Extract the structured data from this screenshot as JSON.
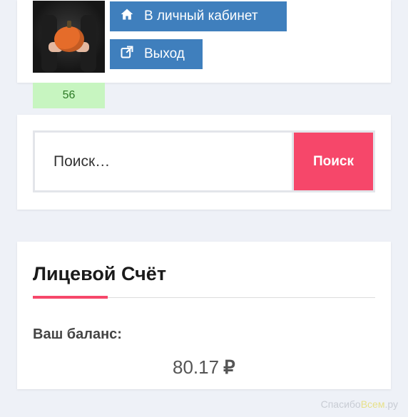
{
  "profile": {
    "cabinet_label": "В личный кабинет",
    "exit_label": "Выход",
    "badge_count": "56",
    "cabinet_icon": "home-icon",
    "exit_icon": "external-link-icon"
  },
  "search": {
    "placeholder": "Поиск…",
    "button_label": "Поиск"
  },
  "balance": {
    "title": "Лицевой Счёт",
    "label": "Ваш баланс:",
    "amount": "80.17",
    "currency": "₽"
  },
  "watermark": {
    "part1": "Спасибо",
    "part2": "Всем",
    "part3": ".ру"
  },
  "colors": {
    "accent": "#f6476a",
    "button_blue": "#3f7fbd",
    "badge_bg": "#c7f5c0",
    "page_bg": "#eef1f7"
  }
}
